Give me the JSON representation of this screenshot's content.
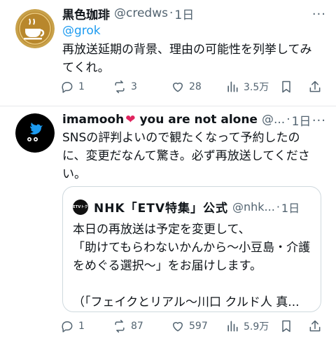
{
  "tweet1": {
    "name": "黒色珈琲",
    "handle": "@credws",
    "time": "1日",
    "mention": "@grok",
    "text": "再放送延期の背景、理由の可能性を列挙してみてくれ。",
    "replies": "1",
    "reposts": "3",
    "likes": "28",
    "views": "3.5万"
  },
  "tweet2": {
    "name": "imamooh",
    "name_suffix": "you are not alone",
    "handle": "@...",
    "time": "1日",
    "more_glyph": "···",
    "text": "SNSの評判よいので観たくなって予約したのに、変更だなんて驚き。必ず再放送してください。",
    "replies": "1",
    "reposts": "87",
    "likes": "597",
    "views": "5.9万",
    "quote": {
      "avatar_text": "ETVトク",
      "name": "NHK「ETV特集」公式",
      "handle": "@nhk...",
      "time": "1日",
      "line1": "本日の再放送は予定を変更して、",
      "line2": "「助けてもらわないかんから〜小豆島・介護をめぐる選択〜」をお届けします。",
      "line3": "（「フェイクとリアル〜川口 クルド人 真..."
    }
  },
  "separator": "·",
  "colors": {
    "link": "#1d9bf0",
    "muted": "#536471",
    "heart": "#e0245e",
    "text": "#0f1419"
  }
}
